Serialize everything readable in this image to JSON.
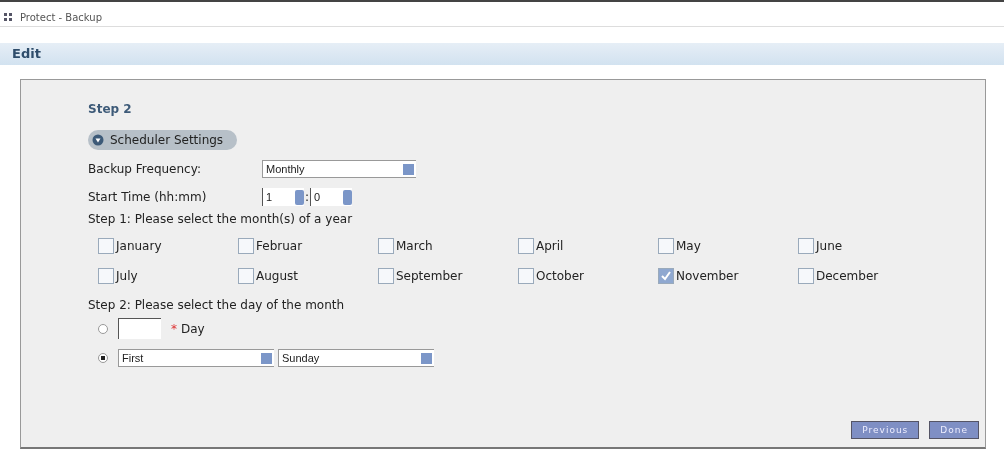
{
  "window": {
    "title": "Protect - Backup"
  },
  "section": {
    "title": "Edit"
  },
  "step_title": "Step 2",
  "group": {
    "label": "Scheduler Settings",
    "expanded": true
  },
  "frequency": {
    "label": "Backup Frequency:",
    "value": "Monthly"
  },
  "start_time": {
    "label": "Start Time (hh:mm)",
    "hour": "1",
    "separator": ":",
    "minute": "0"
  },
  "months_prompt": "Step 1: Please select the month(s) of a year",
  "months": [
    {
      "label": "January",
      "checked": false
    },
    {
      "label": "Februar",
      "checked": false
    },
    {
      "label": "March",
      "checked": false
    },
    {
      "label": "April",
      "checked": false
    },
    {
      "label": "May",
      "checked": false
    },
    {
      "label": "June",
      "checked": false
    },
    {
      "label": "July",
      "checked": false
    },
    {
      "label": "August",
      "checked": false
    },
    {
      "label": "September",
      "checked": false
    },
    {
      "label": "October",
      "checked": false
    },
    {
      "label": "November",
      "checked": true
    },
    {
      "label": "December",
      "checked": false
    }
  ],
  "day_prompt": "Step 2: Please select the day of the month",
  "day_options": [
    {
      "kind": "number",
      "selected": false,
      "required_mark": "*",
      "label": "Day"
    },
    {
      "kind": "weekday",
      "selected": true,
      "ordinal": "First",
      "weekday": "Sunday"
    }
  ],
  "buttons": [
    {
      "label": "Previous"
    },
    {
      "label": "Done"
    }
  ]
}
